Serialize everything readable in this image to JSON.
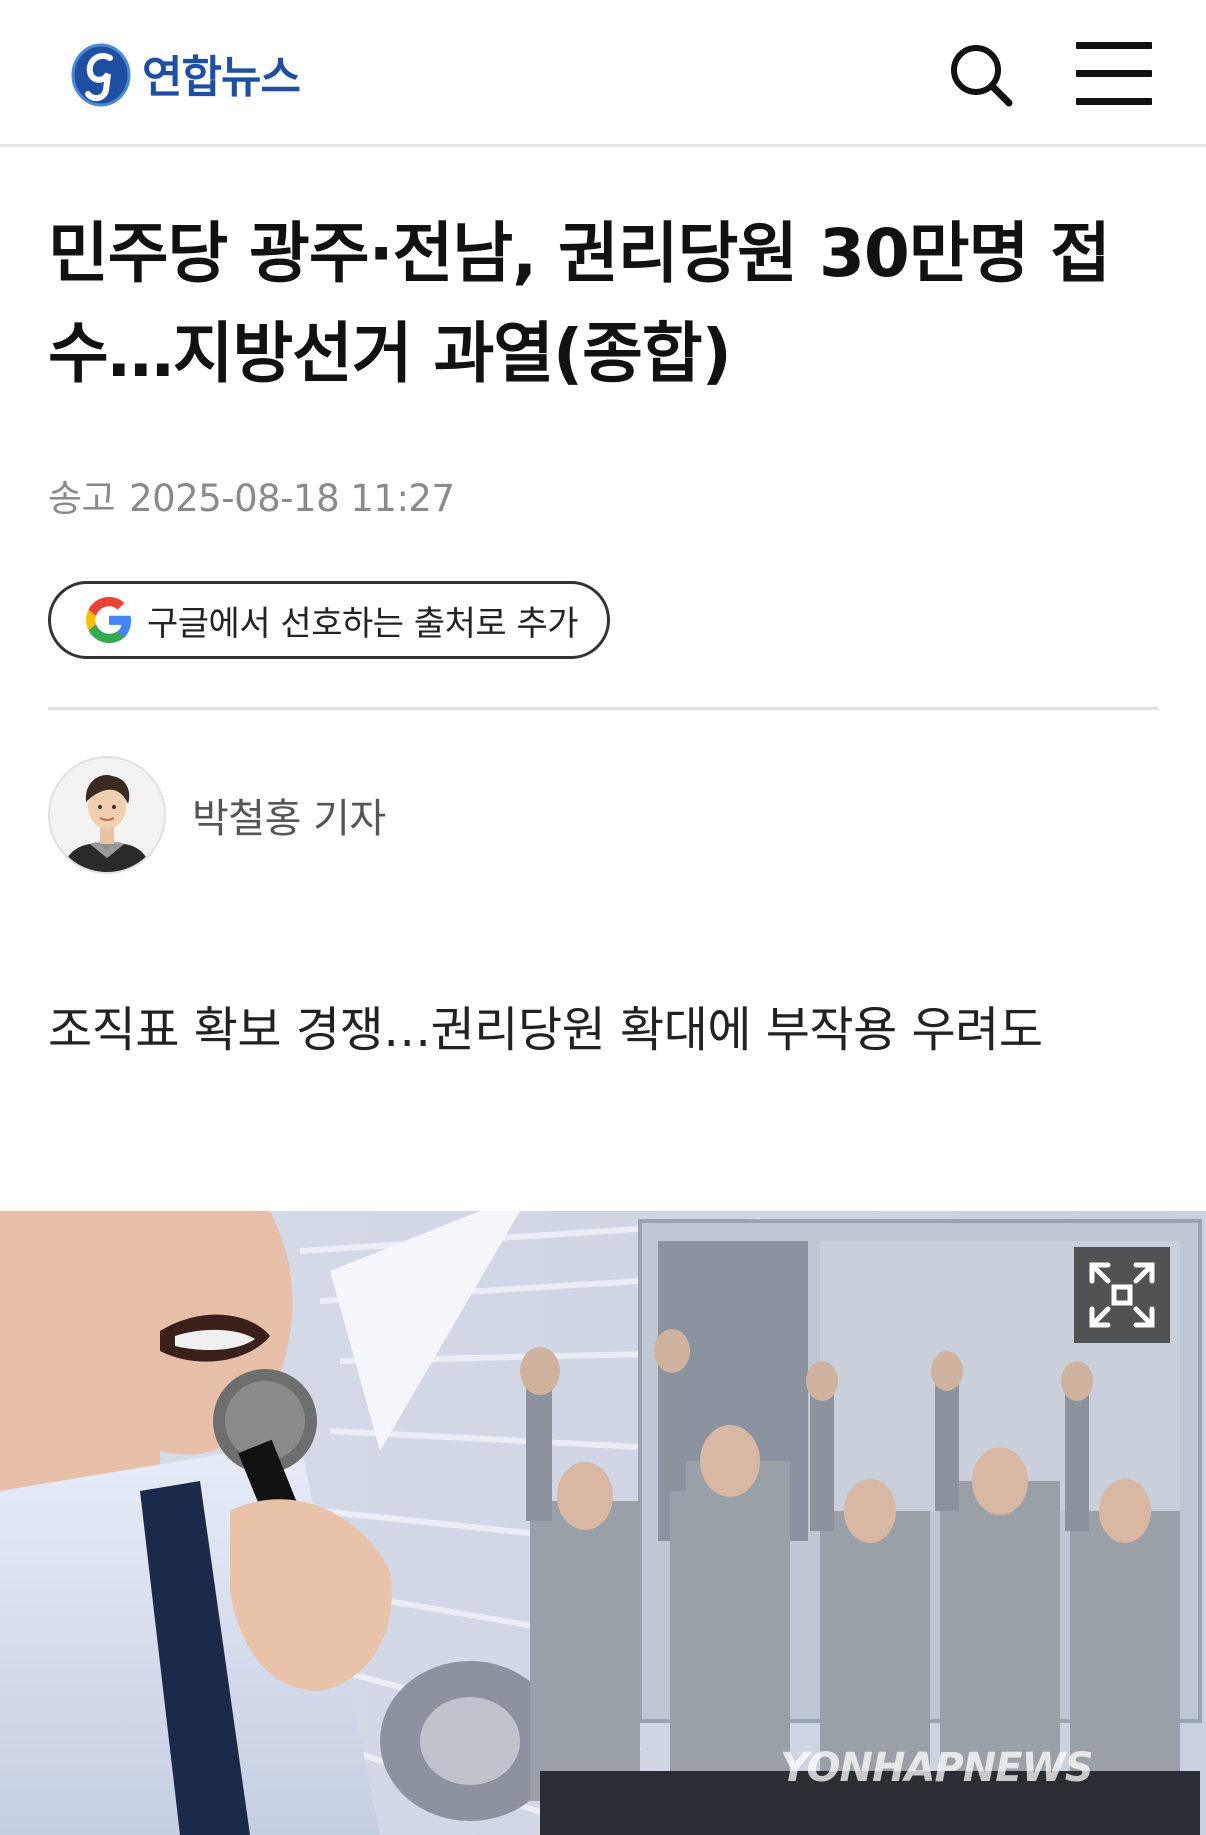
{
  "header": {
    "brand_name": "연합뉴스",
    "brand_color": "#1f4fa3",
    "search_icon": "search-icon",
    "menu_icon": "hamburger-menu-icon"
  },
  "article": {
    "title": "민주당 광주·전남, 권리당원 30만명 접수…지방선거 과열(종합)",
    "meta_label": "송고",
    "timestamp": "2025-08-18 11:27",
    "google_pref_label": "구글에서 선호하는 출처로 추가",
    "reporter": "박철홍 기자",
    "subtitle": "조직표 확보 경쟁…권리당원 확대에 부작용 우려도"
  },
  "photo": {
    "expand_icon": "expand-fullscreen-icon",
    "watermark": "YONHAPNEWS"
  }
}
